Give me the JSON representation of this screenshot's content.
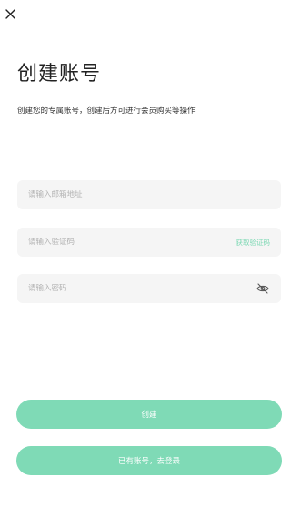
{
  "header": {
    "close_icon": "close-icon"
  },
  "page": {
    "title": "创建账号",
    "subtitle": "创建您的专属账号，创建后方可进行会员购买等操作"
  },
  "form": {
    "email": {
      "placeholder": "请输入邮箱地址",
      "value": ""
    },
    "code": {
      "placeholder": "请输入验证码",
      "value": "",
      "get_code_label": "获取验证码"
    },
    "password": {
      "placeholder": "请输入密码",
      "value": "",
      "toggle_icon": "eye-off-icon"
    }
  },
  "actions": {
    "create_label": "创建",
    "login_label": "已有账号，去登录"
  },
  "colors": {
    "accent": "#7fdab6",
    "accent_text": "#7fd9b5",
    "field_bg": "#f5f5f5",
    "placeholder": "#b3b3b3",
    "title": "#222222"
  }
}
